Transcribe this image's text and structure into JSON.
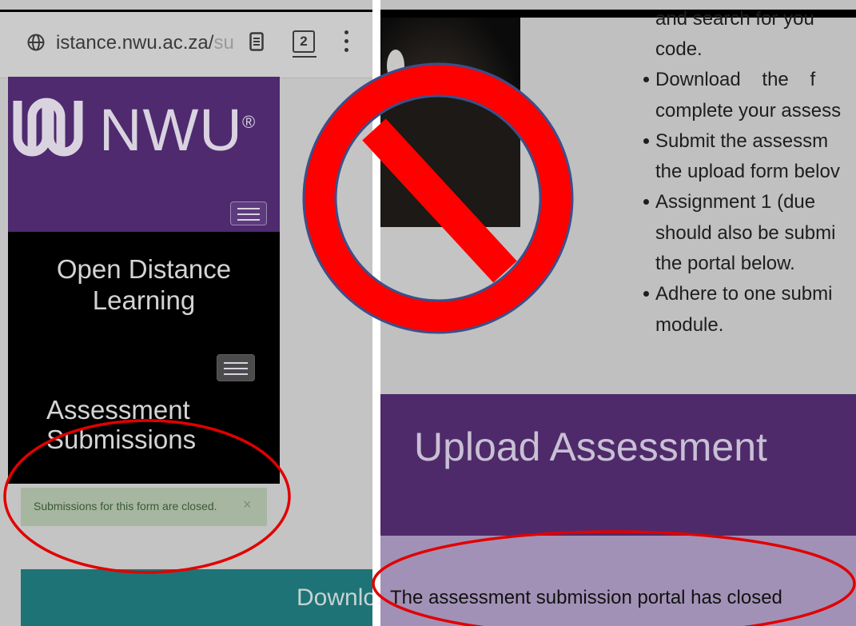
{
  "left_panel": {
    "browser": {
      "url_host": "istance.nwu.ac.za/",
      "url_tail": "su",
      "tab_count": "2"
    },
    "brand": {
      "name": "NWU",
      "registered_mark": "®"
    },
    "site_title": "Open Distance\nLearning",
    "page_title": "Assessment\nSubmissions",
    "alert": {
      "message": "Submissions for this form are closed.",
      "close_glyph": "×"
    },
    "download_button": {
      "label": "Downlo"
    }
  },
  "right_panel": {
    "bullet_lines": [
      "and search for you",
      "code.",
      "Download    the    f",
      "complete your assess",
      "Submit the assessm",
      "the upload form belov",
      "Assignment 1 (due",
      "should also be submi",
      "the portal below.",
      "Adhere to one submi",
      "module."
    ],
    "upload_title": "Upload Assessment",
    "notice": "The assessment submission portal has closed"
  },
  "colors": {
    "nwu_purple": "#4f2a6f",
    "alert_green": "#a6b6a0",
    "teal_button": "#1e7376",
    "notice_lilac": "#a291b6",
    "annotation_red": "#e10000"
  },
  "icons": [
    "globe-icon",
    "reader-mode-icon",
    "tab-switcher-icon",
    "overflow-menu-icon",
    "menu-icon",
    "close-icon",
    "prohibition-sign-icon"
  ]
}
